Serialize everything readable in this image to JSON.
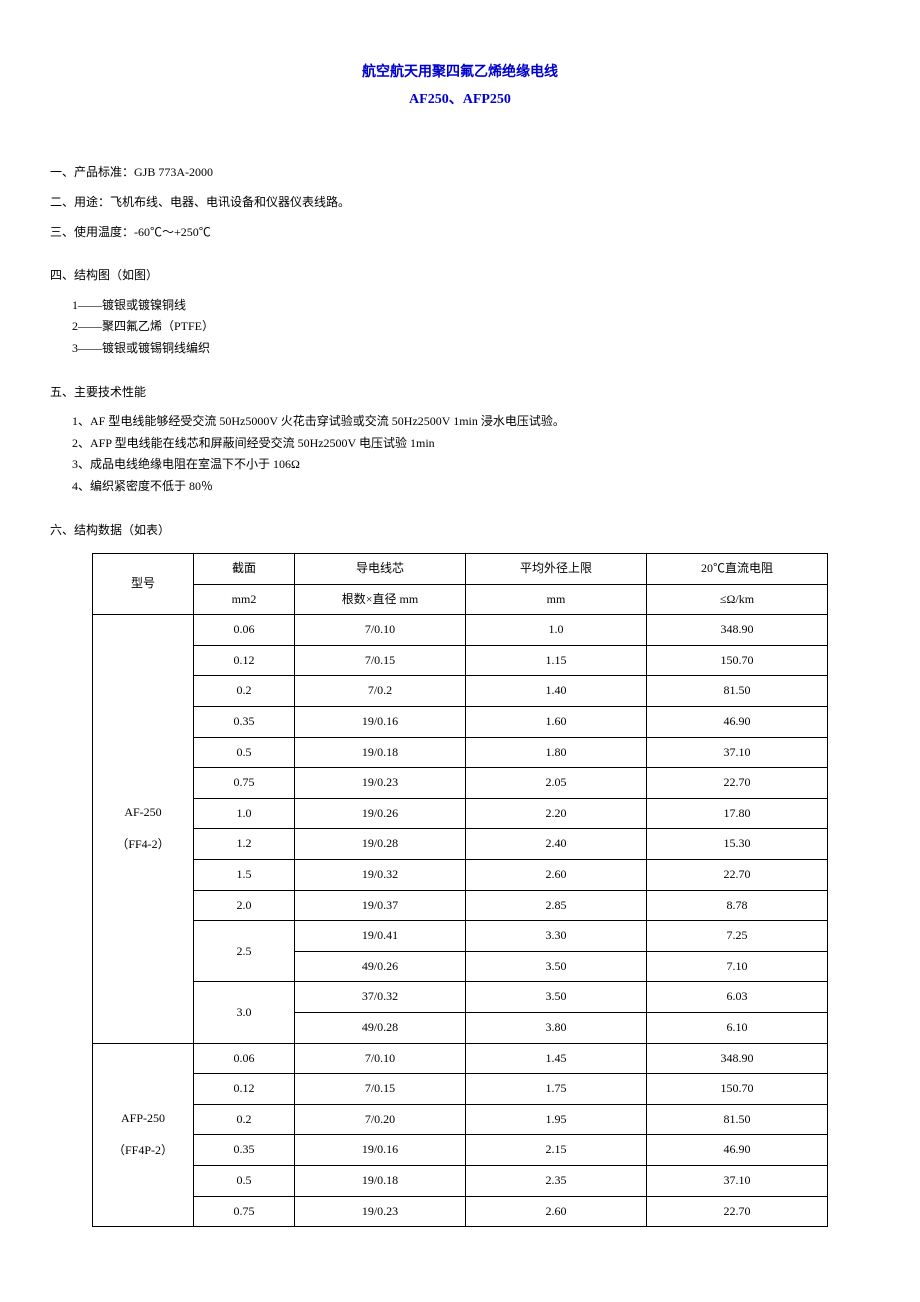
{
  "title": "航空航天用聚四氟乙烯绝缘电线",
  "subtitle": "AF250、AFP250",
  "sections": {
    "s1_label": "一、产品标准：",
    "s1_value": "GJB 773A-2000",
    "s2_label": "二、用途：",
    "s2_value": "飞机布线、电器、电讯设备和仪器仪表线路。",
    "s3_label": "三、使用温度：",
    "s3_value": "-60℃～+250℃",
    "s4_label": "四、结构图（如图）",
    "s4_items": [
      "1——镀银或镀镍铜线",
      "2——聚四氟乙烯（PTFE）",
      "3——镀银或镀锡铜线编织"
    ],
    "s5_label": "五、主要技术性能",
    "s5_items": [
      "1、AF 型电线能够经受交流 50Hz5000V 火花击穿试验或交流 50Hz2500V 1min 浸水电压试验。",
      "2、AFP 型电线能在线芯和屏蔽间经受交流 50Hz2500V 电压试验 1min",
      "3、成品电线绝缘电阻在室温下不小于 106Ω",
      "4、编织紧密度不低于 80％"
    ],
    "s6_label": "六、结构数据（如表）"
  },
  "table": {
    "headers": {
      "model": "型号",
      "cs_top": "截面",
      "cs_bot": "mm2",
      "cond_top": "导电线芯",
      "cond_bot": "根数×直径 mm",
      "diam_top": "平均外径上限",
      "diam_bot": "mm",
      "res_top": "20℃直流电阻",
      "res_bot": "≤Ω/km"
    },
    "group1_model_line1": "AF-250",
    "group1_model_line2": "（FF4-2）",
    "group1": [
      {
        "cs": "0.06",
        "cond": "7/0.10",
        "diam": "1.0",
        "res": "348.90",
        "cs_rowspan": 1
      },
      {
        "cs": "0.12",
        "cond": "7/0.15",
        "diam": "1.15",
        "res": "150.70",
        "cs_rowspan": 1
      },
      {
        "cs": "0.2",
        "cond": "7/0.2",
        "diam": "1.40",
        "res": "81.50",
        "cs_rowspan": 1
      },
      {
        "cs": "0.35",
        "cond": "19/0.16",
        "diam": "1.60",
        "res": "46.90",
        "cs_rowspan": 1
      },
      {
        "cs": "0.5",
        "cond": "19/0.18",
        "diam": "1.80",
        "res": "37.10",
        "cs_rowspan": 1
      },
      {
        "cs": "0.75",
        "cond": "19/0.23",
        "diam": "2.05",
        "res": "22.70",
        "cs_rowspan": 1
      },
      {
        "cs": "1.0",
        "cond": "19/0.26",
        "diam": "2.20",
        "res": "17.80",
        "cs_rowspan": 1
      },
      {
        "cs": "1.2",
        "cond": "19/0.28",
        "diam": "2.40",
        "res": "15.30",
        "cs_rowspan": 1
      },
      {
        "cs": "1.5",
        "cond": "19/0.32",
        "diam": "2.60",
        "res": "22.70",
        "cs_rowspan": 1
      },
      {
        "cs": "2.0",
        "cond": "19/0.37",
        "diam": "2.85",
        "res": "8.78",
        "cs_rowspan": 1
      },
      {
        "cs": "2.5",
        "cond": "19/0.41",
        "diam": "3.30",
        "res": "7.25",
        "cs_rowspan": 2
      },
      {
        "cs": "",
        "cond": "49/0.26",
        "diam": "3.50",
        "res": "7.10",
        "cs_rowspan": 0
      },
      {
        "cs": "3.0",
        "cond": "37/0.32",
        "diam": "3.50",
        "res": "6.03",
        "cs_rowspan": 2
      },
      {
        "cs": "",
        "cond": "49/0.28",
        "diam": "3.80",
        "res": "6.10",
        "cs_rowspan": 0
      }
    ],
    "group2_model_line1": "AFP-250",
    "group2_model_line2": "（FF4P-2）",
    "group2": [
      {
        "cs": "0.06",
        "cond": "7/0.10",
        "diam": "1.45",
        "res": "348.90"
      },
      {
        "cs": "0.12",
        "cond": "7/0.15",
        "diam": "1.75",
        "res": "150.70"
      },
      {
        "cs": "0.2",
        "cond": "7/0.20",
        "diam": "1.95",
        "res": "81.50"
      },
      {
        "cs": "0.35",
        "cond": "19/0.16",
        "diam": "2.15",
        "res": "46.90"
      },
      {
        "cs": "0.5",
        "cond": "19/0.18",
        "diam": "2.35",
        "res": "37.10"
      },
      {
        "cs": "0.75",
        "cond": "19/0.23",
        "diam": "2.60",
        "res": "22.70"
      }
    ]
  }
}
